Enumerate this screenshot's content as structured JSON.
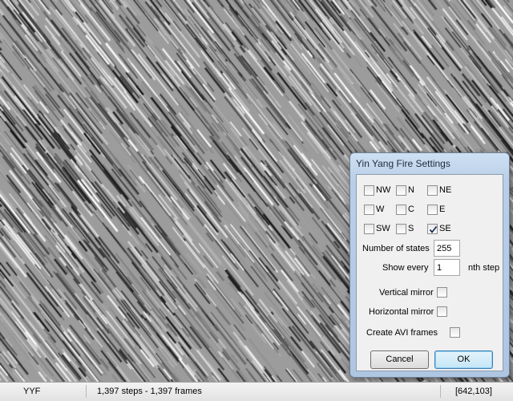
{
  "dialog": {
    "title": "Yin Yang Fire Settings",
    "directions": [
      {
        "label": "NW",
        "checked": false
      },
      {
        "label": "N",
        "checked": false
      },
      {
        "label": "NE",
        "checked": false
      },
      {
        "label": "W",
        "checked": false
      },
      {
        "label": "C",
        "checked": false
      },
      {
        "label": "E",
        "checked": false
      },
      {
        "label": "SW",
        "checked": false
      },
      {
        "label": "S",
        "checked": false
      },
      {
        "label": "SE",
        "checked": true
      }
    ],
    "states_label": "Number of states",
    "states_value": "255",
    "show_every_label": "Show every",
    "show_every_value": "1",
    "show_every_suffix": "nth step",
    "vertical_mirror_label": "Vertical mirror",
    "vertical_mirror_checked": false,
    "horizontal_mirror_label": "Horizontal mirror",
    "horizontal_mirror_checked": false,
    "avi_label": "Create AVI frames",
    "avi_checked": false,
    "cancel_label": "Cancel",
    "ok_label": "OK"
  },
  "status": {
    "name": "YYF",
    "progress": "1,397 steps - 1,397 frames",
    "coords": "[642,103]"
  }
}
